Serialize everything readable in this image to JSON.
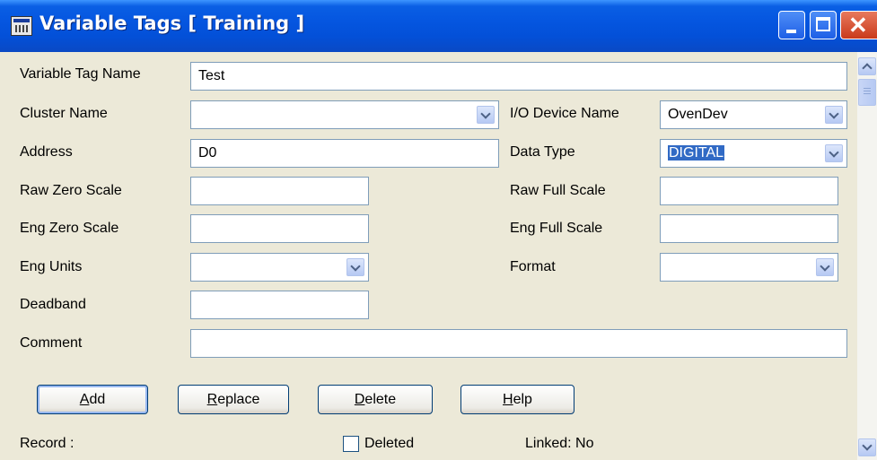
{
  "window": {
    "title": "Variable Tags [ Training ]"
  },
  "form": {
    "variable_tag_name": {
      "label": "Variable Tag Name",
      "value": "Test"
    },
    "cluster_name": {
      "label": "Cluster Name",
      "value": ""
    },
    "io_device_name": {
      "label": "I/O Device Name",
      "value": "OvenDev"
    },
    "address": {
      "label": "Address",
      "value": "D0"
    },
    "data_type": {
      "label": "Data Type",
      "value": "DIGITAL"
    },
    "raw_zero_scale": {
      "label": "Raw Zero Scale",
      "value": ""
    },
    "raw_full_scale": {
      "label": "Raw Full Scale",
      "value": ""
    },
    "eng_zero_scale": {
      "label": "Eng Zero Scale",
      "value": ""
    },
    "eng_full_scale": {
      "label": "Eng Full Scale",
      "value": ""
    },
    "eng_units": {
      "label": "Eng Units",
      "value": ""
    },
    "format": {
      "label": "Format",
      "value": ""
    },
    "deadband": {
      "label": "Deadband",
      "value": ""
    },
    "comment": {
      "label": "Comment",
      "value": ""
    }
  },
  "buttons": {
    "add": {
      "underline": "A",
      "rest": "dd"
    },
    "replace": {
      "underline": "R",
      "rest": "eplace"
    },
    "delete": {
      "underline": "D",
      "rest": "elete"
    },
    "help": {
      "underline": "H",
      "rest": "elp"
    }
  },
  "status": {
    "record": "Record :",
    "deleted_label": "Deleted",
    "deleted_checked": false,
    "linked": "Linked: No"
  }
}
